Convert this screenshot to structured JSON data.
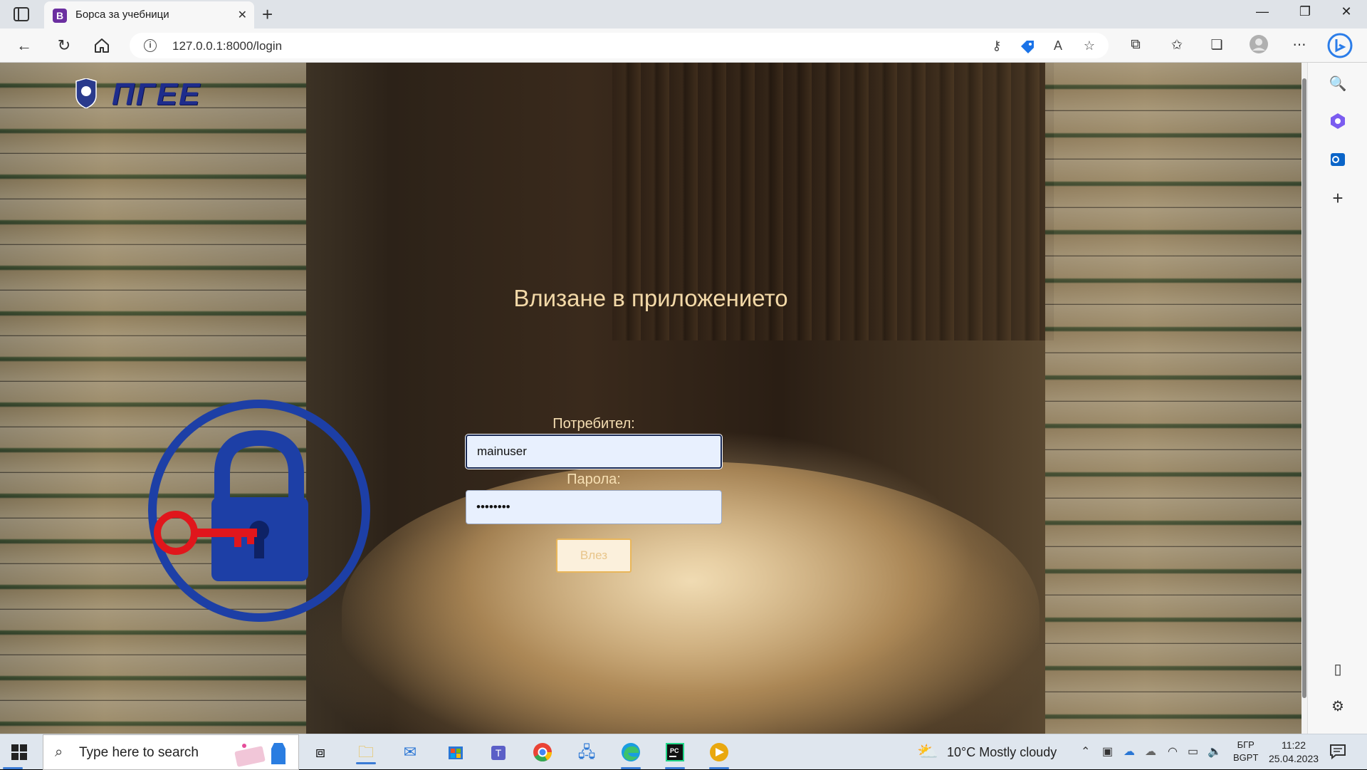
{
  "browser": {
    "tab": {
      "favicon_letter": "B",
      "title": "Борса за учебници",
      "close": "✕"
    },
    "new_tab": "+",
    "window": {
      "minimize": "—",
      "maximize": "❐",
      "close": "✕"
    },
    "url": "127.0.0.1:8000/login",
    "url_info": "i"
  },
  "page": {
    "logo_text": "ПГЕЕ",
    "heading": "Влизане в приложението",
    "form": {
      "username_label": "Потребител:",
      "username_value": "mainuser",
      "password_label": "Парола:",
      "password_value": "••••••••",
      "submit_label": "Влез"
    }
  },
  "taskbar": {
    "search_placeholder": "Type here to search",
    "weather": "10°C  Mostly cloudy",
    "lang_line1": "БГР",
    "lang_line2": "BGPT",
    "time": "11:22",
    "date": "25.04.2023"
  },
  "colors": {
    "heading": "#f3d9a8",
    "lock_blue": "#1d3fa6",
    "key_red": "#e0161c",
    "button_border": "#e9b65a"
  }
}
